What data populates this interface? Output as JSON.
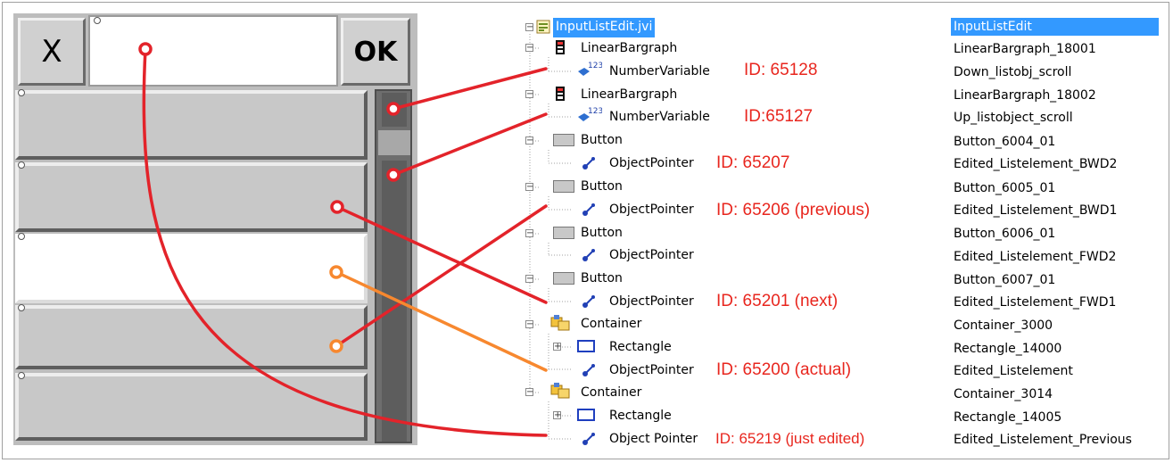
{
  "panel": {
    "cancel_label": "X",
    "ok_label": "OK"
  },
  "tree": {
    "nodes": [
      {
        "label": "InputListEdit.jvi",
        "name": "InputListEdit",
        "id_note": ""
      },
      {
        "label": "LinearBargraph",
        "name": "LinearBargraph_18001",
        "id_note": ""
      },
      {
        "label": "NumberVariable",
        "name": "Down_listobj_scroll",
        "id_note": "ID: 65128"
      },
      {
        "label": "LinearBargraph",
        "name": "LinearBargraph_18002",
        "id_note": ""
      },
      {
        "label": "NumberVariable",
        "name": "Up_listobject_scroll",
        "id_note": "ID:65127"
      },
      {
        "label": "Button",
        "name": "Button_6004_01",
        "id_note": ""
      },
      {
        "label": "ObjectPointer",
        "name": "Edited_Listelement_BWD2",
        "id_note": "ID: 65207"
      },
      {
        "label": "Button",
        "name": "Button_6005_01",
        "id_note": ""
      },
      {
        "label": "ObjectPointer",
        "name": "Edited_Listelement_BWD1",
        "id_note": "ID: 65206 (previous)"
      },
      {
        "label": "Button",
        "name": "Button_6006_01",
        "id_note": ""
      },
      {
        "label": "ObjectPointer",
        "name": "Edited_Listelement_FWD2",
        "id_note": ""
      },
      {
        "label": "Button",
        "name": "Button_6007_01",
        "id_note": ""
      },
      {
        "label": "ObjectPointer",
        "name": "Edited_Listelement_FWD1",
        "id_note": "ID: 65201 (next)"
      },
      {
        "label": "Container",
        "name": "Container_3000",
        "id_note": ""
      },
      {
        "label": "Rectangle",
        "name": "Rectangle_14000",
        "id_note": ""
      },
      {
        "label": "ObjectPointer",
        "name": "Edited_Listelement",
        "id_note": "ID: 65200 (actual)"
      },
      {
        "label": "Container",
        "name": "Container_3014",
        "id_note": ""
      },
      {
        "label": "Rectangle",
        "name": "Rectangle_14005",
        "id_note": ""
      },
      {
        "label": "Object Pointer",
        "name": "Edited_Listelement_Previous",
        "id_note": "ID: 65219 (just edited)"
      }
    ]
  },
  "colors": {
    "connector_red": "#e3232a",
    "connector_orange": "#f7882f",
    "selection_blue": "#3399ff"
  }
}
